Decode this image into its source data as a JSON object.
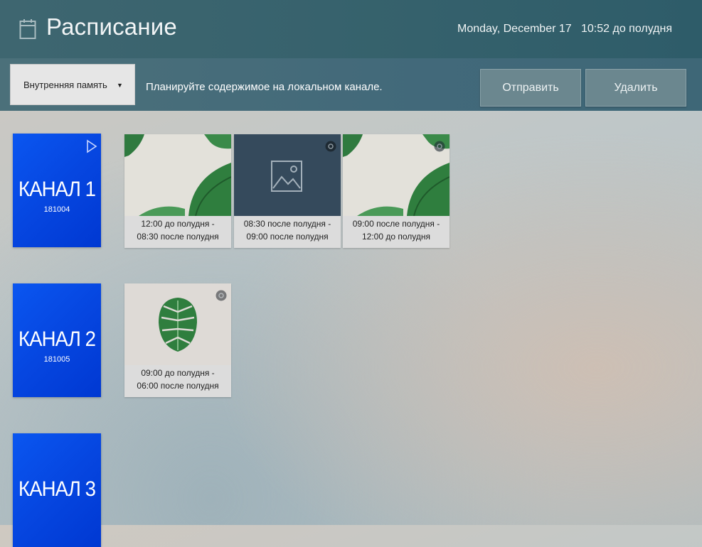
{
  "header": {
    "title": "Расписание",
    "date": "Monday, December 17",
    "time": "10:52 до полудня",
    "icon": "calendar-icon"
  },
  "toolbar": {
    "storage_value": "Внутренняя память",
    "hint": "Планируйте содержимое на локальном канале.",
    "send_label": "Отправить",
    "delete_label": "Удалить"
  },
  "channels": [
    {
      "name": "КАНАЛ 1",
      "code": "181004",
      "items": [
        {
          "time_line1": "12:00 до полудня -",
          "time_line2": "08:30 после полудня",
          "thumb": "tropical-leaves"
        },
        {
          "time_line1": "08:30 после полудня -",
          "time_line2": "09:00 после полудня",
          "thumb": "image-placeholder"
        },
        {
          "time_line1": "09:00 после полудня -",
          "time_line2": "12:00 до полудня",
          "thumb": "tropical-leaves"
        }
      ]
    },
    {
      "name": "КАНАЛ 2",
      "code": "181005",
      "items": [
        {
          "time_line1": "09:00 до полудня -",
          "time_line2": "06:00 после полудня",
          "thumb": "monstera-leaf"
        }
      ]
    },
    {
      "name": "КАНАЛ 3",
      "code": "",
      "items": []
    }
  ],
  "colors": {
    "header_bg": "#3e6670",
    "channel_tile": "#0646e0",
    "button_bg": "#6b878f"
  }
}
